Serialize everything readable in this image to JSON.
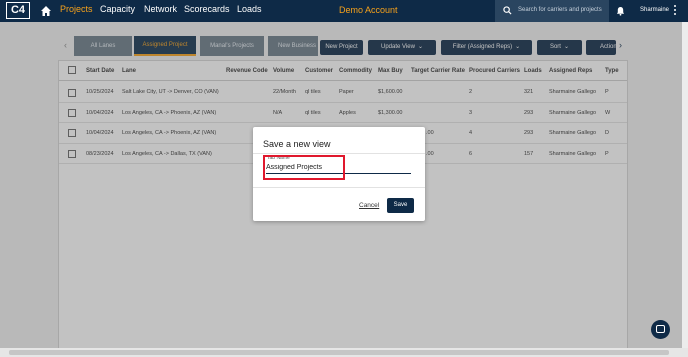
{
  "nav": {
    "logo": "C4",
    "links": [
      "Projects",
      "Capacity",
      "Network",
      "Scorecards",
      "Loads"
    ],
    "demo_label": "Demo Account",
    "search_placeholder": "Search for carriers and projects",
    "user": "Sharmaine"
  },
  "tabs": {
    "items": [
      "All Lanes",
      "Assigned Project",
      "Manal's Projects",
      "New Business"
    ],
    "active": "Assigned Project",
    "prev_arrow": "‹",
    "next_arrow": "›"
  },
  "toolbar": {
    "new_project": "New Project",
    "update_view": "Update View",
    "filter": "Filter (Assigned Reps)",
    "sort": "Sort",
    "actions": "Actions"
  },
  "table": {
    "columns": [
      "Start Date",
      "Lane",
      "Revenue Code",
      "Volume",
      "Customer",
      "Commodity",
      "Max Buy",
      "Target Carrier Rate",
      "Procured Carriers",
      "Loads",
      "Assigned Reps",
      "Type"
    ],
    "rows": [
      [
        "10/25/2024",
        "Salt Lake City, UT -> Denver, CO (VAN)",
        "",
        "22/Month",
        "ql tiles",
        "Paper",
        "$1,600.00",
        "",
        "2",
        "321",
        "Sharmaine Gallego",
        "P"
      ],
      [
        "10/04/2024",
        "Los Angeles, CA -> Phoenix, AZ (VAN)",
        "",
        "N/A",
        "ql tiles",
        "Apples",
        "$1,300.00",
        "",
        "3",
        "293",
        "Sharmaine Gallego",
        "W"
      ],
      [
        "10/04/2024",
        "Los Angeles, CA -> Phoenix, AZ (VAN)",
        "",
        "",
        "",
        "",
        "",
        ".00",
        "4",
        "293",
        "Sharmaine Gallego",
        "D"
      ],
      [
        "08/23/2024",
        "Los Angeles, CA -> Dallas, TX (VAN)",
        "",
        "",
        "",
        "",
        "",
        ".00",
        "6",
        "157",
        "Sharmaine Gallego",
        "P"
      ]
    ]
  },
  "modal": {
    "title": "Save a new view",
    "field_label": "Tab Name",
    "field_value": "Assigned Projects",
    "cancel": "Cancel",
    "save": "Save"
  },
  "colors": {
    "navy": "#0e2a47",
    "accent": "#f7a21b",
    "highlight": "#e0182d"
  }
}
